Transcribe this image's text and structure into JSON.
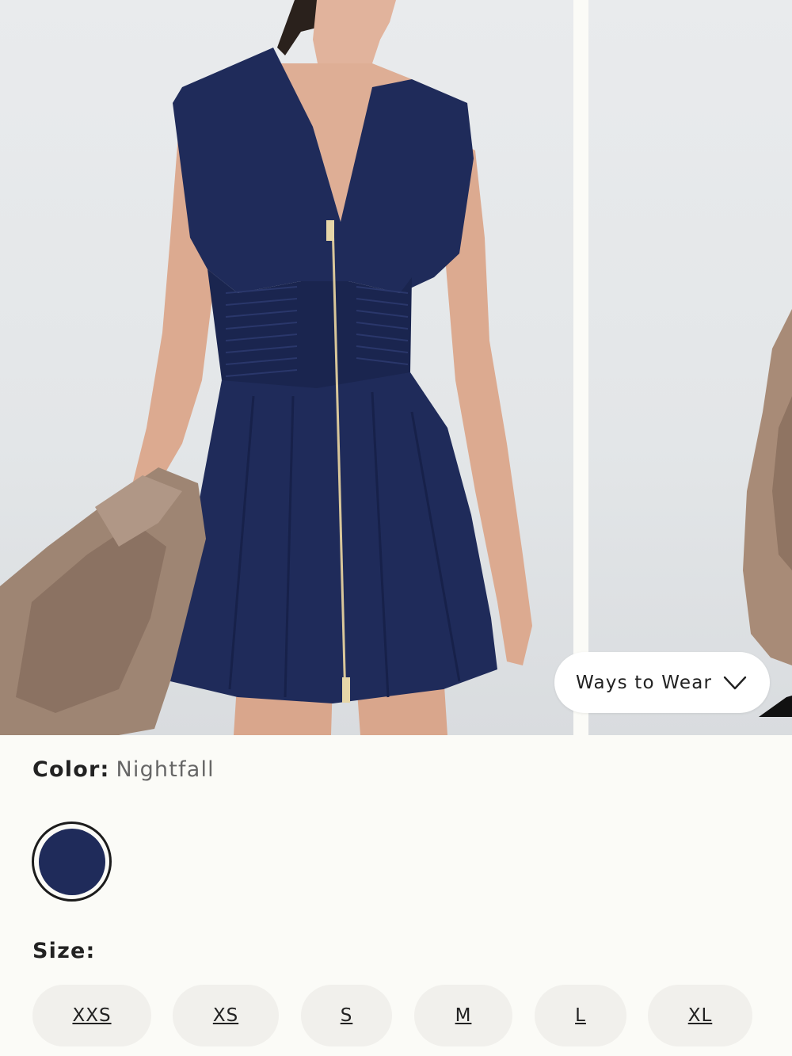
{
  "gallery": {
    "ways_to_wear_label": "Ways to Wear",
    "ways_to_wear_icon": "chevron-down-icon"
  },
  "color": {
    "label": "Color:",
    "value": "Nightfall",
    "swatches": [
      {
        "name": "Nightfall",
        "hex": "#1f2b5a",
        "selected": true
      }
    ]
  },
  "size": {
    "label": "Size:",
    "options": [
      "XXS",
      "XS",
      "S",
      "M",
      "L",
      "XL"
    ]
  },
  "colors": {
    "background": "#fbfbf7",
    "dress": "#1f2b5a",
    "jacket": "#9e8573",
    "size_button_bg": "#f1f0ec"
  }
}
